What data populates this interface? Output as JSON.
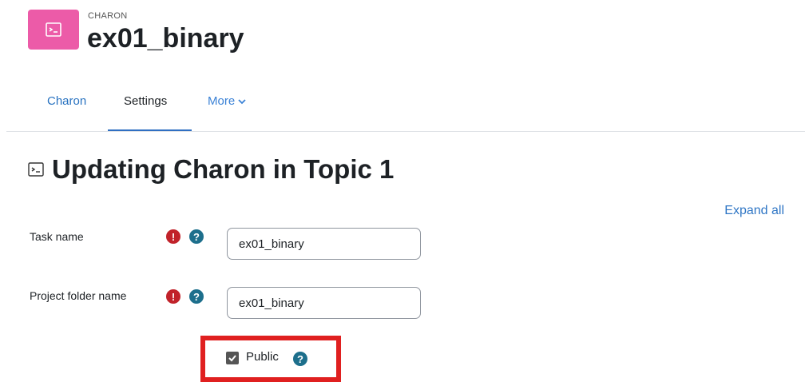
{
  "header": {
    "kicker": "CHARON",
    "title": "ex01_binary"
  },
  "tabs": {
    "charon": "Charon",
    "settings": "Settings",
    "more": "More"
  },
  "page": {
    "heading": "Updating Charon in Topic 1",
    "expand_all": "Expand all"
  },
  "form": {
    "task_name": {
      "label": "Task name",
      "value": "ex01_binary"
    },
    "project_folder": {
      "label": "Project folder name",
      "value": "ex01_binary"
    },
    "public": {
      "label": "Public",
      "checked": true
    }
  },
  "colors": {
    "app_icon": "#ec5ba8",
    "link": "#2f76c5",
    "required": "#c1222a",
    "help": "#1d6f8c",
    "highlight": "#e02020"
  },
  "icons": {
    "app": "terminal-icon",
    "required": "exclamation-icon",
    "help": "question-icon",
    "more": "chevron-down-icon"
  }
}
